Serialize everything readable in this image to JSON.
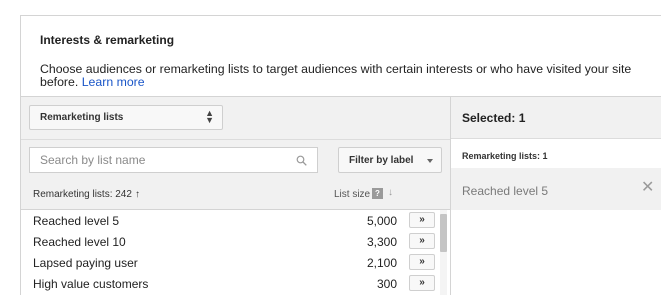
{
  "header": {
    "title": "Interests & remarketing",
    "description": "Choose audiences or remarketing lists to target audiences with certain interests or who have visited your site before.",
    "learn_more": "Learn more"
  },
  "type_select": {
    "value": "Remarketing lists"
  },
  "search": {
    "placeholder": "Search by list name"
  },
  "filter": {
    "label": "Filter by label"
  },
  "list": {
    "header_name": "Remarketing lists: 242",
    "header_size": "List size",
    "help_icon_label": "?",
    "rows": [
      {
        "name": "Reached level 5",
        "size": "5,000",
        "action": "»"
      },
      {
        "name": "Reached level 10",
        "size": "3,300",
        "action": "»"
      },
      {
        "name": "Lapsed paying user",
        "size": "2,100",
        "action": "»"
      },
      {
        "name": "High value customers",
        "size": "300",
        "action": "»"
      }
    ]
  },
  "selected": {
    "title": "Selected: 1",
    "subtitle": "Remarketing lists: 1",
    "items": [
      {
        "name": "Reached level 5"
      }
    ]
  },
  "colors": {
    "link": "#1a56c8",
    "panel_bg": "#f1f1f1",
    "border": "#d4d4d4"
  },
  "icons": {
    "search": "search-icon",
    "close": "close-icon",
    "sort_up": "sort-up-icon",
    "sort_down": "sort-down-icon"
  }
}
